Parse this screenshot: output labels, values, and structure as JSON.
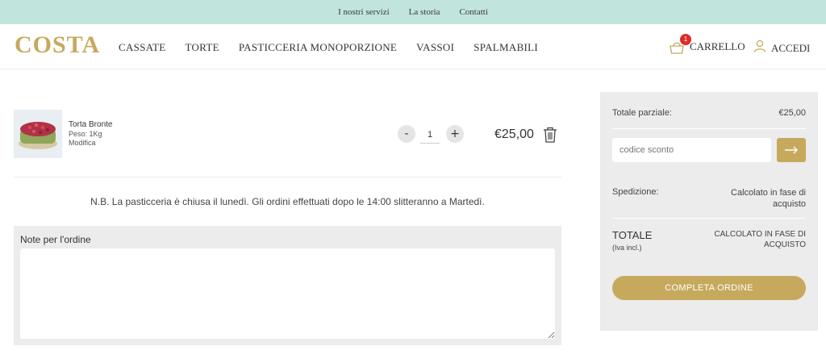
{
  "topbar": {
    "links": [
      "I nostri servizi",
      "La storia",
      "Contatti"
    ]
  },
  "header": {
    "logo": "COSTA",
    "nav": [
      "CASSATE",
      "TORTE",
      "PASTICCERIA MONOPORZIONE",
      "VASSOI",
      "SPALMABILI"
    ],
    "cart_label": "CARRELLO",
    "cart_count": "1",
    "login_label": "ACCEDI"
  },
  "cart": {
    "item": {
      "name": "Torta Bronte",
      "weight": "Peso: 1Kg",
      "edit_label": "Modifica",
      "minus": "-",
      "plus": "+",
      "quantity": "1",
      "price": "€25,00"
    },
    "notice": "N.B. La pasticceria è chiusa il lunedì. Gli ordini effettuati dopo le 14:00 slitteranno a Martedì.",
    "notes_label": "Note per l'ordine",
    "notes_value": ""
  },
  "summary": {
    "subtotal_label": "Totale parziale:",
    "subtotal_value": "€25,00",
    "coupon_placeholder": "codice sconto",
    "shipping_label": "Spedizione:",
    "shipping_value": "Calcolato in fase di acquisto",
    "total_label": "TOTALE",
    "total_sub": "(Iva incl.)",
    "total_value": "CALCOLATO IN FASE DI ACQUISTO",
    "checkout_label": "COMPLETA ORDINE"
  },
  "colors": {
    "topbar": "#c1e4dc",
    "accent": "#c6a95c",
    "badge": "#e02b2b",
    "panel": "#ececec"
  }
}
